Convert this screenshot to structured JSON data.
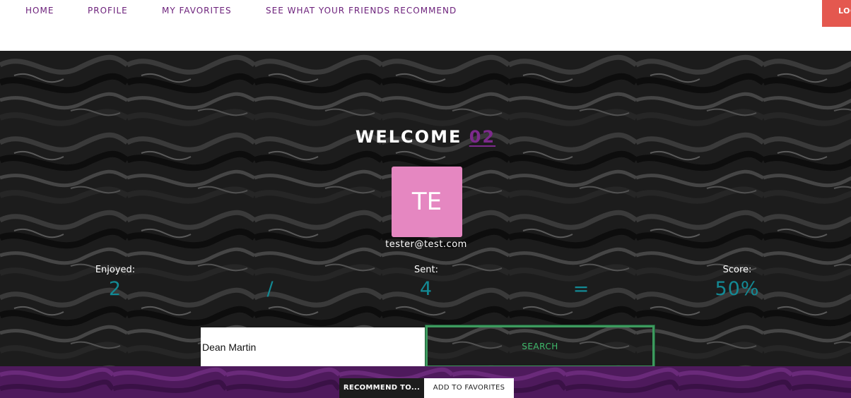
{
  "nav": {
    "home": "HOME",
    "profile": "PROFILE",
    "favorites": "MY FAVORITES",
    "friends": "SEE WHAT YOUR FRIENDS RECOMMEND",
    "logout": "LOG"
  },
  "welcome": {
    "prefix": "WELCOME",
    "username": "02"
  },
  "avatar": {
    "initials": "TE"
  },
  "email": "tester@test.com",
  "stats": {
    "enjoyed_label": "Enjoyed:",
    "enjoyed_value": "2",
    "divide_symbol": "/",
    "sent_label": "Sent:",
    "sent_value": "4",
    "equals_symbol": "=",
    "score_label": "Score:",
    "score_value": "50%"
  },
  "search": {
    "value": "Dean Martin",
    "button_label": "SEARCH"
  },
  "actions": {
    "recommend_label": "RECOMMEND TO...",
    "add_favorites_label": "ADD TO FAVORITES"
  },
  "colors": {
    "accent_purple": "#6b1f7a",
    "logout_red": "#e4584f",
    "avatar_pink": "#e587c1",
    "stat_teal": "#138a95",
    "search_green": "#3d9a5e",
    "band_purple": "#4e1a5c"
  }
}
